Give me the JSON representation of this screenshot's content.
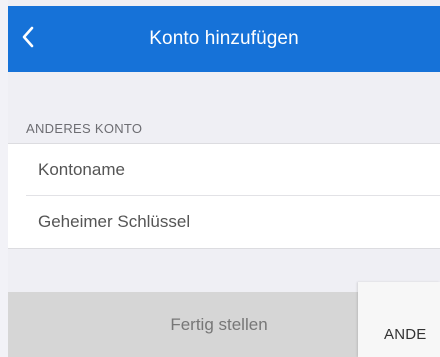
{
  "navbar": {
    "title": "Konto hinzufügen",
    "back_icon": "chevron-left-icon",
    "background": "#1672d8"
  },
  "section": {
    "header": "ANDERES KONTO",
    "fields": {
      "account_name_placeholder": "Kontoname",
      "secret_key_placeholder": "Geheimer Schlüssel"
    }
  },
  "footer": {
    "done_label": "Fertig stellen",
    "side_label": "ANDE"
  }
}
